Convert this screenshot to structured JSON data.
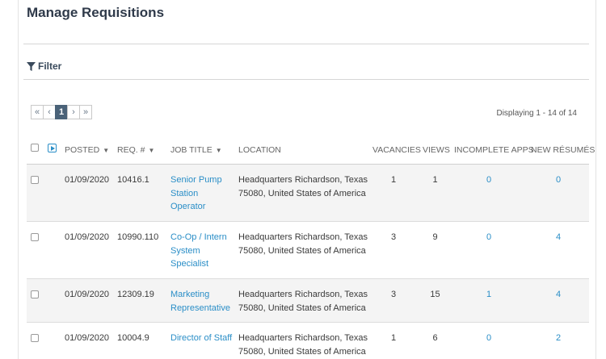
{
  "page": {
    "title": "Manage Requisitions"
  },
  "filter": {
    "label": "Filter",
    "icon": "funnel-icon"
  },
  "pager": {
    "first": "«",
    "prev": "‹",
    "current": "1",
    "next": "›",
    "last": "»"
  },
  "displaying": "Displaying 1 - 14 of 14",
  "columns": {
    "posted": "POSTED",
    "req": "REQ. #",
    "title": "JOB TITLE",
    "location": "LOCATION",
    "vacancies": "VACANCIES",
    "views": "VIEWS",
    "incomplete": "INCOMPLETE APPS",
    "new_resumes": "NEW RÉSUMÉS"
  },
  "rows": [
    {
      "posted": "01/09/2020",
      "req": "10416.1",
      "title": "Senior Pump Station Operator",
      "location": "Headquarters Richardson, Texas 75080, United States of America",
      "vacancies": "1",
      "views": "1",
      "incomplete": "0",
      "new_resumes": "0"
    },
    {
      "posted": "01/09/2020",
      "req": "10990.110",
      "title": "Co-Op / Intern System Specialist",
      "location": "Headquarters Richardson, Texas 75080, United States of America",
      "vacancies": "3",
      "views": "9",
      "incomplete": "0",
      "new_resumes": "4"
    },
    {
      "posted": "01/09/2020",
      "req": "12309.19",
      "title": "Marketing Representative",
      "location": "Headquarters Richardson, Texas 75080, United States of America",
      "vacancies": "3",
      "views": "15",
      "incomplete": "1",
      "new_resumes": "4"
    },
    {
      "posted": "01/09/2020",
      "req": "10004.9",
      "title": "Director of Staff",
      "location": "Headquarters Richardson, Texas 75080, United States of America",
      "vacancies": "1",
      "views": "6",
      "incomplete": "0",
      "new_resumes": "2"
    }
  ],
  "colors": {
    "link": "#2a8ec7",
    "pager_active": "#4a6278",
    "row_stripe": "#f4f4f4"
  }
}
